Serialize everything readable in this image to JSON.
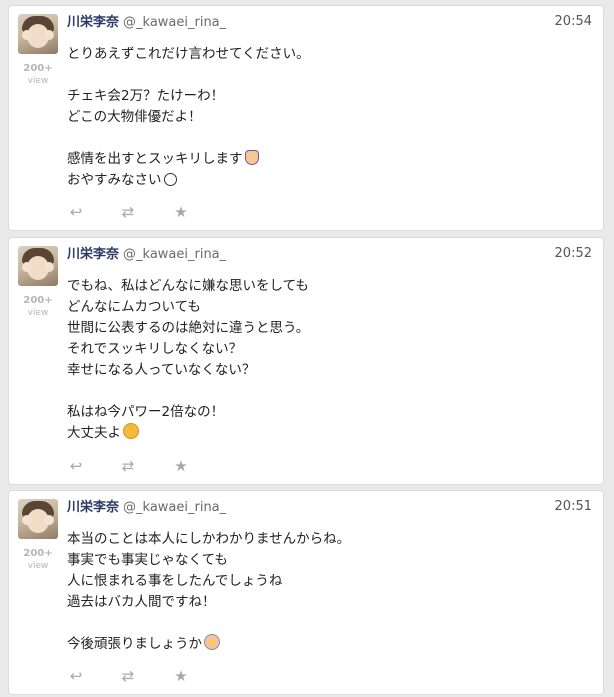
{
  "tweets": [
    {
      "name": "川栄李奈",
      "handle": "@_kawaei_rina_",
      "time": "20:54",
      "views": "200+",
      "views_label": "view",
      "lines": [
        "とりあえずこれだけ言わせてください。",
        "",
        "チェキ会2万？たけーわ！",
        "どこの大物俳優だよ！",
        "",
        "感情を出すとスッキリします",
        "おやすみなさい"
      ],
      "emoji": [
        "person-emoji",
        "smile-emoji"
      ]
    },
    {
      "name": "川栄李奈",
      "handle": "@_kawaei_rina_",
      "time": "20:52",
      "views": "200+",
      "views_label": "view",
      "lines": [
        "でもね、私はどんなに嫌な思いをしても",
        "どんなにムカついても",
        "世間に公表するのは絶対に違うと思う。",
        "それでスッキリしなくない？",
        "幸せになる人っていなくない？",
        "",
        "私はね今パワー2倍なの！",
        "大丈夫よ"
      ],
      "emoji": [
        "blush-emoji"
      ]
    },
    {
      "name": "川栄李奈",
      "handle": "@_kawaei_rina_",
      "time": "20:51",
      "views": "200+",
      "views_label": "view",
      "lines": [
        "本当のことは本人にしかわかりませんからね。",
        "事実でも事実じゃなくても",
        "人に恨まれる事をしたんでしょうね",
        "過去はバカ人間ですね！",
        "",
        "今後頑張りましょうか"
      ],
      "emoji": [
        "flower-emoji"
      ]
    }
  ],
  "icons": {
    "reply": "reply-icon",
    "retweet": "retweet-icon",
    "favorite": "star-icon"
  }
}
